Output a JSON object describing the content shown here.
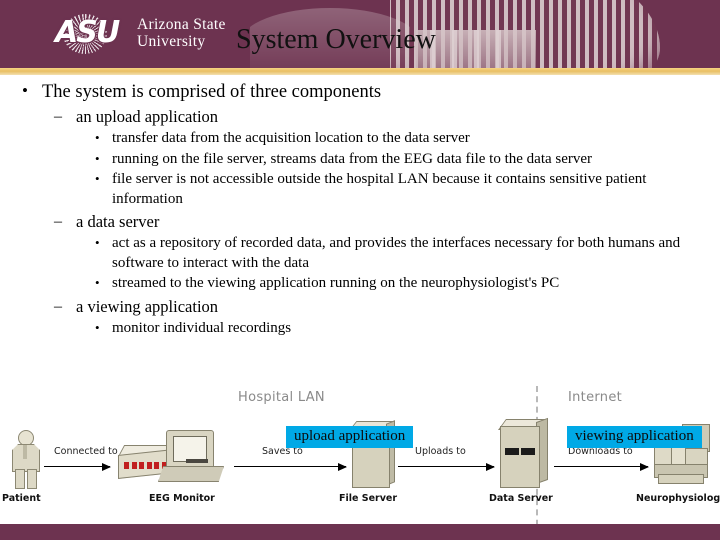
{
  "header": {
    "logo_line1": "Arizona State",
    "logo_line2": "University",
    "logo_mark": "ASU",
    "title": "System Overview"
  },
  "bullets": [
    {
      "level": 1,
      "text": "The system is comprised of three components"
    },
    {
      "level": 2,
      "text": "an upload application"
    },
    {
      "level": 3,
      "text": "transfer data from the acquisition location to the data server"
    },
    {
      "level": 3,
      "text": "running on the file server, streams data from the EEG data file to the data server"
    },
    {
      "level": 3,
      "text": "file server is not accessible outside the hospital LAN because it contains sensitive patient information"
    },
    {
      "level": 2,
      "text": "a data server"
    },
    {
      "level": 3,
      "text": "act as a repository of recorded data, and provides the interfaces necessary for both humans and software to interact with the data"
    },
    {
      "level": 3,
      "text": "streamed to the viewing application running on the neurophysiologist's PC"
    },
    {
      "level": 2,
      "text": "a viewing application"
    },
    {
      "level": 3,
      "text": "monitor individual recordings"
    }
  ],
  "diagram": {
    "zones": [
      {
        "label": "Hospital LAN"
      },
      {
        "label": "Internet"
      }
    ],
    "nodes": [
      {
        "label": "Patient"
      },
      {
        "label": "EEG Monitor"
      },
      {
        "label": "File Server"
      },
      {
        "label": "Data Server"
      },
      {
        "label": "Neurophysiologist"
      }
    ],
    "arrows": [
      {
        "label": "Connected to"
      },
      {
        "label": "Saves to"
      },
      {
        "label": "Uploads to"
      },
      {
        "label": "Downloads to"
      }
    ],
    "highlights": [
      {
        "label": "upload application"
      },
      {
        "label": "viewing application"
      }
    ]
  },
  "colors": {
    "maroon": "#6d3350",
    "gold": "#e9bf63",
    "highlight": "#00a9e6",
    "zone_text": "#8a8a8a"
  }
}
